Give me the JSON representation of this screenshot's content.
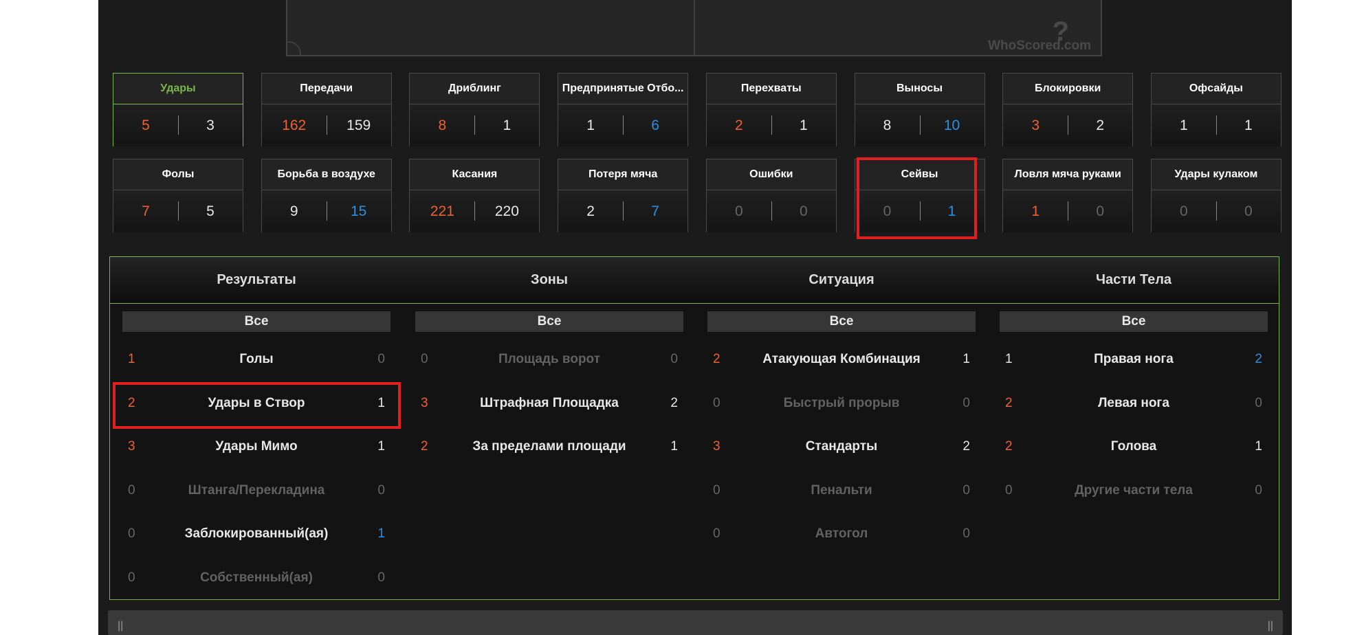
{
  "watermark": "WhoScored.com",
  "stat_tiles": [
    {
      "title": "Удары",
      "left": "5",
      "right": "3",
      "lc": "o",
      "rc": "w",
      "selected": true
    },
    {
      "title": "Передачи",
      "left": "162",
      "right": "159",
      "lc": "o",
      "rc": "w"
    },
    {
      "title": "Дриблинг",
      "left": "8",
      "right": "1",
      "lc": "o",
      "rc": "w"
    },
    {
      "title": "Предпринятые Отбо...",
      "left": "1",
      "right": "6",
      "lc": "w",
      "rc": "b"
    },
    {
      "title": "Перехваты",
      "left": "2",
      "right": "1",
      "lc": "o",
      "rc": "w"
    },
    {
      "title": "Выносы",
      "left": "8",
      "right": "10",
      "lc": "w",
      "rc": "b"
    },
    {
      "title": "Блокировки",
      "left": "3",
      "right": "2",
      "lc": "o",
      "rc": "w"
    },
    {
      "title": "Офсайды",
      "left": "1",
      "right": "1",
      "lc": "w",
      "rc": "w"
    },
    {
      "title": "Фолы",
      "left": "7",
      "right": "5",
      "lc": "o",
      "rc": "w"
    },
    {
      "title": "Борьба в воздухе",
      "left": "9",
      "right": "15",
      "lc": "w",
      "rc": "b"
    },
    {
      "title": "Касания",
      "left": "221",
      "right": "220",
      "lc": "o",
      "rc": "w"
    },
    {
      "title": "Потеря мяча",
      "left": "2",
      "right": "7",
      "lc": "w",
      "rc": "b"
    },
    {
      "title": "Ошибки",
      "left": "0",
      "right": "0",
      "lc": "g",
      "rc": "g"
    },
    {
      "title": "Сейвы",
      "left": "0",
      "right": "1",
      "lc": "g",
      "rc": "b"
    },
    {
      "title": "Ловля мяча руками",
      "left": "1",
      "right": "0",
      "lc": "o",
      "rc": "g"
    },
    {
      "title": "Удары кулаком",
      "left": "0",
      "right": "0",
      "lc": "g",
      "rc": "g"
    }
  ],
  "columns": [
    {
      "header": "Результаты",
      "all_label": "Все",
      "rows": [
        {
          "a": "1",
          "label": "Голы",
          "b": "0",
          "ac": "o",
          "bc": "g",
          "on": true
        },
        {
          "a": "2",
          "label": "Удары в Створ",
          "b": "1",
          "ac": "o",
          "bc": "w",
          "on": true
        },
        {
          "a": "3",
          "label": "Удары Мимо",
          "b": "1",
          "ac": "o",
          "bc": "w",
          "on": true
        },
        {
          "a": "0",
          "label": "Штанга/Перекладина",
          "b": "0",
          "ac": "g",
          "bc": "g",
          "on": false
        },
        {
          "a": "0",
          "label": "Заблокированный(ая)",
          "b": "1",
          "ac": "g",
          "bc": "b",
          "on": true
        },
        {
          "a": "0",
          "label": "Собственный(ая)",
          "b": "0",
          "ac": "g",
          "bc": "g",
          "on": false
        }
      ]
    },
    {
      "header": "Зоны",
      "all_label": "Все",
      "rows": [
        {
          "a": "0",
          "label": "Площадь ворот",
          "b": "0",
          "ac": "g",
          "bc": "g",
          "on": false
        },
        {
          "a": "3",
          "label": "Штрафная Площадка",
          "b": "2",
          "ac": "o",
          "bc": "w",
          "on": true
        },
        {
          "a": "2",
          "label": "За пределами площади",
          "b": "1",
          "ac": "o",
          "bc": "w",
          "on": true
        }
      ]
    },
    {
      "header": "Ситуация",
      "all_label": "Все",
      "rows": [
        {
          "a": "2",
          "label": "Атакующая Комбинация",
          "b": "1",
          "ac": "o",
          "bc": "w",
          "on": true
        },
        {
          "a": "0",
          "label": "Быстрый прорыв",
          "b": "0",
          "ac": "g",
          "bc": "g",
          "on": false
        },
        {
          "a": "3",
          "label": "Стандарты",
          "b": "2",
          "ac": "o",
          "bc": "w",
          "on": true
        },
        {
          "a": "0",
          "label": "Пенальти",
          "b": "0",
          "ac": "g",
          "bc": "g",
          "on": false
        },
        {
          "a": "0",
          "label": "Автогол",
          "b": "0",
          "ac": "g",
          "bc": "g",
          "on": false
        }
      ]
    },
    {
      "header": "Части Тела",
      "all_label": "Все",
      "rows": [
        {
          "a": "1",
          "label": "Правая нога",
          "b": "2",
          "ac": "w",
          "bc": "b",
          "on": true
        },
        {
          "a": "2",
          "label": "Левая нога",
          "b": "0",
          "ac": "o",
          "bc": "g",
          "on": true
        },
        {
          "a": "2",
          "label": "Голова",
          "b": "1",
          "ac": "o",
          "bc": "w",
          "on": true
        },
        {
          "a": "0",
          "label": "Другие части тела",
          "b": "0",
          "ac": "g",
          "bc": "g",
          "on": false
        }
      ]
    }
  ],
  "colors": {
    "orange": "#f06030",
    "blue": "#2a8fe0",
    "green": "#7ab648",
    "highlight": "#e02020"
  }
}
